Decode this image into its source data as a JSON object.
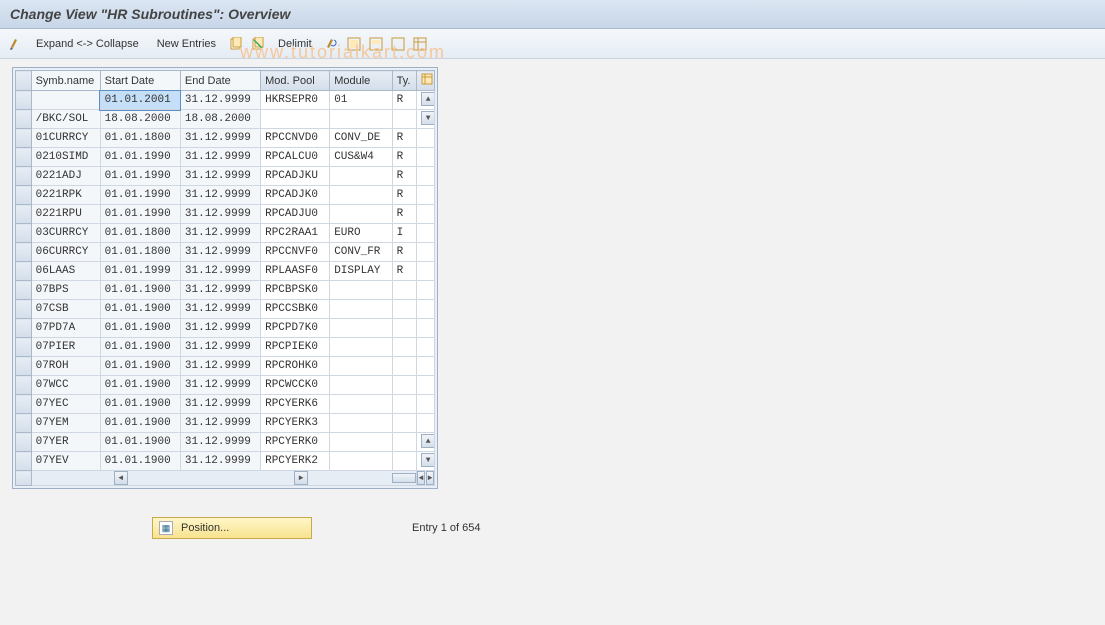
{
  "title": "Change View \"HR Subroutines\": Overview",
  "toolbar": {
    "expand_collapse": "Expand <-> Collapse",
    "new_entries": "New Entries",
    "delimit": "Delimit"
  },
  "columns": {
    "symb": "Symb.name",
    "start": "Start Date",
    "end": "End Date",
    "pool": "Mod. Pool",
    "module": "Module",
    "ty": "Ty."
  },
  "rows": [
    {
      "symb": "",
      "start": "01.01.2001",
      "end": "31.12.9999",
      "pool": "HKRSEPR0",
      "module": "01",
      "ty": "R",
      "sel": true
    },
    {
      "symb": "/BKC/SOL",
      "start": "18.08.2000",
      "end": "18.08.2000",
      "pool": "",
      "module": "",
      "ty": ""
    },
    {
      "symb": "01CURRCY",
      "start": "01.01.1800",
      "end": "31.12.9999",
      "pool": "RPCCNVD0",
      "module": "CONV_DE",
      "ty": "R"
    },
    {
      "symb": "0210SIMD",
      "start": "01.01.1990",
      "end": "31.12.9999",
      "pool": "RPCALCU0",
      "module": "CUS&W4",
      "ty": "R"
    },
    {
      "symb": "0221ADJ",
      "start": "01.01.1990",
      "end": "31.12.9999",
      "pool": "RPCADJKU",
      "module": "",
      "ty": "R"
    },
    {
      "symb": "0221RPK",
      "start": "01.01.1990",
      "end": "31.12.9999",
      "pool": "RPCADJK0",
      "module": "",
      "ty": "R"
    },
    {
      "symb": "0221RPU",
      "start": "01.01.1990",
      "end": "31.12.9999",
      "pool": "RPCADJU0",
      "module": "",
      "ty": "R"
    },
    {
      "symb": "03CURRCY",
      "start": "01.01.1800",
      "end": "31.12.9999",
      "pool": "RPC2RAA1",
      "module": "EURO",
      "ty": "I"
    },
    {
      "symb": "06CURRCY",
      "start": "01.01.1800",
      "end": "31.12.9999",
      "pool": "RPCCNVF0",
      "module": "CONV_FR",
      "ty": "R"
    },
    {
      "symb": "06LAAS",
      "start": "01.01.1999",
      "end": "31.12.9999",
      "pool": "RPLAASF0",
      "module": "DISPLAY",
      "ty": "R"
    },
    {
      "symb": "07BPS",
      "start": "01.01.1900",
      "end": "31.12.9999",
      "pool": "RPCBPSK0",
      "module": "",
      "ty": ""
    },
    {
      "symb": "07CSB",
      "start": "01.01.1900",
      "end": "31.12.9999",
      "pool": "RPCCSBK0",
      "module": "",
      "ty": ""
    },
    {
      "symb": "07PD7A",
      "start": "01.01.1900",
      "end": "31.12.9999",
      "pool": "RPCPD7K0",
      "module": "",
      "ty": ""
    },
    {
      "symb": "07PIER",
      "start": "01.01.1900",
      "end": "31.12.9999",
      "pool": "RPCPIEK0",
      "module": "",
      "ty": ""
    },
    {
      "symb": "07ROH",
      "start": "01.01.1900",
      "end": "31.12.9999",
      "pool": "RPCROHK0",
      "module": "",
      "ty": ""
    },
    {
      "symb": "07WCC",
      "start": "01.01.1900",
      "end": "31.12.9999",
      "pool": "RPCWCCK0",
      "module": "",
      "ty": ""
    },
    {
      "symb": "07YEC",
      "start": "01.01.1900",
      "end": "31.12.9999",
      "pool": "RPCYERK6",
      "module": "",
      "ty": ""
    },
    {
      "symb": "07YEM",
      "start": "01.01.1900",
      "end": "31.12.9999",
      "pool": "RPCYERK3",
      "module": "",
      "ty": ""
    },
    {
      "symb": "07YER",
      "start": "01.01.1900",
      "end": "31.12.9999",
      "pool": "RPCYERK0",
      "module": "",
      "ty": ""
    },
    {
      "symb": "07YEV",
      "start": "01.01.1900",
      "end": "31.12.9999",
      "pool": "RPCYERK2",
      "module": "",
      "ty": ""
    }
  ],
  "position_btn": "Position...",
  "entry_status": "Entry 1 of 654"
}
